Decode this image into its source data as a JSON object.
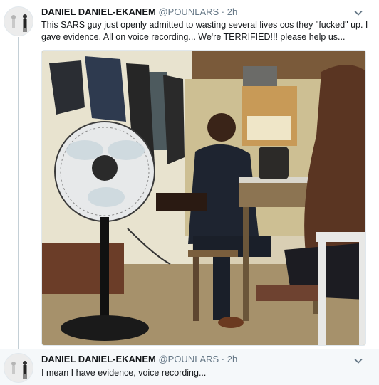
{
  "tweets": [
    {
      "display_name": "DANIEL DANIEL-EKANEM",
      "handle": "@POUNLARS",
      "separator": "·",
      "timestamp": "2h",
      "text": "This SARS guy just openly admitted to wasting several lives cos they \"fucked\" up. I gave evidence. All on voice recording... We're TERRIFIED!!! please help us...",
      "media_icon": "photo"
    },
    {
      "display_name": "DANIEL DANIEL-EKANEM",
      "handle": "@POUNLARS",
      "separator": "·",
      "timestamp": "2h",
      "text": "I mean I have evidence, voice recording..."
    }
  ],
  "icons": {
    "caret": "chevron-down-icon"
  },
  "colors": {
    "name": "#14171a",
    "meta": "#657786",
    "thread_line": "#c4cfd6",
    "reply_background": "#f5f8fa"
  }
}
